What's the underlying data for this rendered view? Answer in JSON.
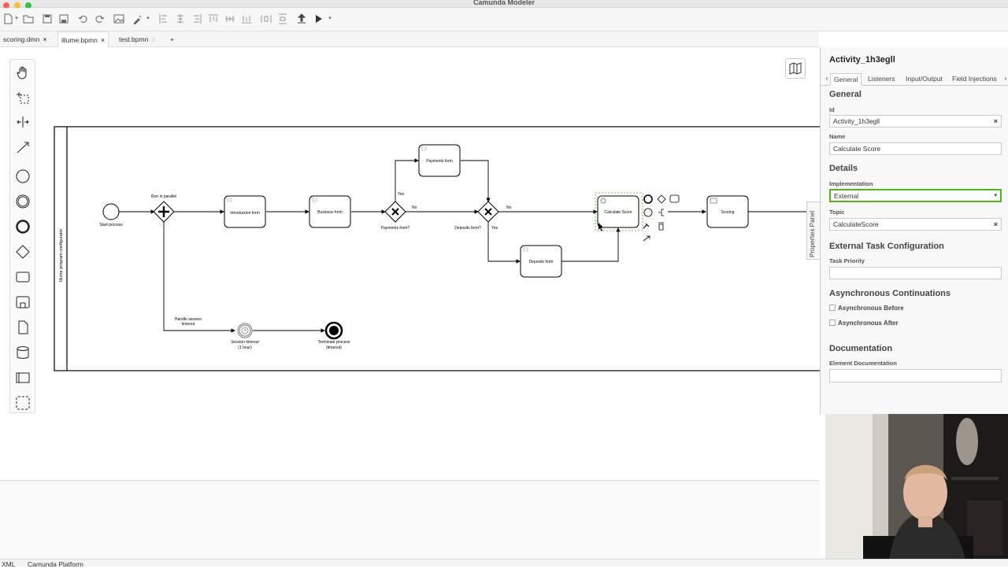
{
  "window": {
    "title": "Camunda Modeler"
  },
  "tabs": [
    {
      "label": "scoring.dmn",
      "active": false,
      "close": "×"
    },
    {
      "label": "illume.bpmn",
      "active": true,
      "close": "×"
    },
    {
      "label": "test.bpmn",
      "active": false,
      "close": "○"
    },
    {
      "label": "+"
    }
  ],
  "diagram": {
    "pool_label": "Illume program configurator",
    "start_event": "Start process",
    "parallel_gateway_label": "Run in parallel",
    "tasks": {
      "introduction": "Introduction form",
      "business": "Business form",
      "payments": "Payments form",
      "deposits": "Deposits form",
      "calculate": "Calculate Score",
      "scoring": "Scoring"
    },
    "gateways": {
      "payments": "Payments form?",
      "deposits": "Deposits form?"
    },
    "flow_labels": {
      "yes1": "Yes",
      "no1": "No",
      "no2": "No",
      "yes2": "Yes",
      "timeout": "Handle session timeout"
    },
    "timer_event": "Session timeout (1 hour)",
    "end_event": "Terminate process (timeout)"
  },
  "properties": {
    "element_id_title": "Activity_1h3egll",
    "tabs": [
      "General",
      "Listeners",
      "Input/Output",
      "Field Injections"
    ],
    "sections": {
      "general": "General",
      "details": "Details",
      "external": "External Task Configuration",
      "async": "Asynchronous Continuations",
      "docs": "Documentation"
    },
    "fields": {
      "id_label": "Id",
      "id_value": "Activity_1h3egll",
      "name_label": "Name",
      "name_value": "Calculate Score",
      "impl_label": "Implementation",
      "impl_value": "External",
      "topic_label": "Topic",
      "topic_value": "CalculateScore",
      "priority_label": "Task Priority",
      "priority_value": "",
      "async_before": "Asynchronous Before",
      "async_after": "Asynchronous After",
      "doc_label": "Element Documentation",
      "doc_value": ""
    },
    "side_toggle": "Properties Panel"
  },
  "status": {
    "left": "XML",
    "engine": "Camunda Platform"
  },
  "colors": {
    "accent": "#52b415",
    "selection": "#52b415"
  }
}
